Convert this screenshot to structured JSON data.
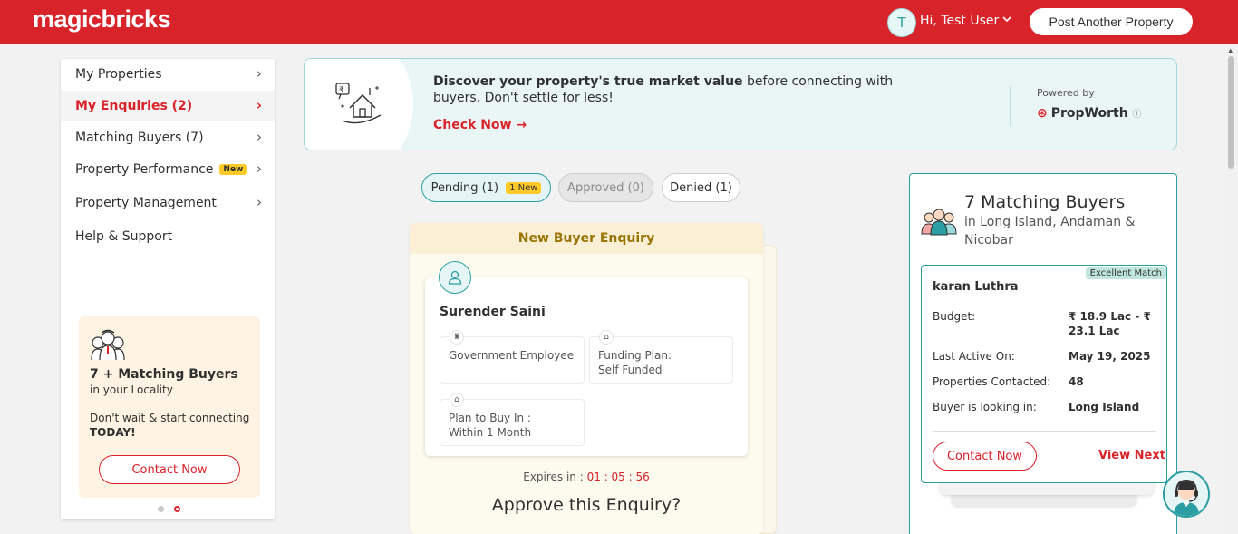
{
  "header": {
    "logo": "magicbricks",
    "avatar_initial": "T",
    "greeting": "Hi, Test User",
    "post_button": "Post Another Property"
  },
  "sidebar": {
    "items": [
      {
        "label": "My Properties"
      },
      {
        "label": "My Enquiries (2)"
      },
      {
        "label": "Matching Buyers (7)"
      },
      {
        "label": "Property Performance",
        "tag": "New"
      },
      {
        "label": "Property Management"
      },
      {
        "label": "Help & Support"
      }
    ],
    "promo": {
      "title": "7 + Matching Buyers",
      "subtitle": "in your Locality",
      "text1": "Don't wait & start connecting",
      "text2": "TODAY!",
      "button": "Contact Now"
    }
  },
  "banner": {
    "bold_text": "Discover your property's true market value",
    "text_rest": " before connecting with",
    "line2": "buyers. Don't settle for less!",
    "link": "Check Now",
    "powered_by": "Powered by",
    "brand": "PropWorth"
  },
  "tabs": {
    "pending": "Pending (1)",
    "pending_new": "1 New",
    "approved": "Approved (0)",
    "denied": "Denied (1)"
  },
  "enquiry": {
    "header": "New Buyer Enquiry",
    "buyer_name": "Surender Saini",
    "occupation": "Government Employee",
    "funding_label": "Funding Plan:",
    "funding_value": "Self Funded",
    "plan_label": "Plan to Buy In :",
    "plan_value": "Within 1 Month",
    "expires_label": "Expires in :",
    "expires_time": "01 : 05 : 56",
    "approve_question": "Approve this Enquiry?"
  },
  "matching_buyers": {
    "title": "7 Matching Buyers",
    "subtitle_line1": "in Long Island, Andaman &",
    "subtitle_line2": "Nicobar",
    "card": {
      "badge": "Excellent Match",
      "name": "karan Luthra",
      "budget_label": "Budget:",
      "budget_value_1": "₹ 18.9 Lac - ₹",
      "budget_value_2": "23.1 Lac",
      "last_active_label": "Last Active On:",
      "last_active_value": "May 19, 2025",
      "contacted_label": "Properties Contacted:",
      "contacted_value": "48",
      "looking_label": "Buyer is looking in:",
      "looking_value": "Long Island",
      "contact_button": "Contact Now",
      "next_link": "View Next"
    }
  },
  "colors": {
    "brand_red": "#d8232a",
    "teal": "#2a9ea3",
    "new_tag": "#ffc928"
  }
}
